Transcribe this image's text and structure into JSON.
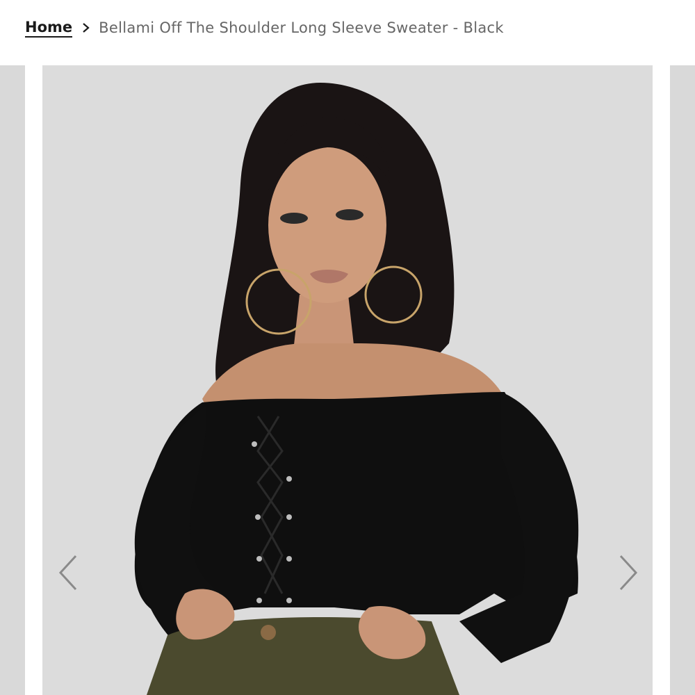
{
  "breadcrumb": {
    "home_label": "Home",
    "current_label": "Bellami Off The Shoulder Long Sleeve Sweater - Black"
  },
  "gallery": {
    "main_image_icon": "product-photo",
    "prev_icon": "chevron-left-icon",
    "next_icon": "chevron-right-icon"
  },
  "colors": {
    "background": "#ffffff",
    "slide_bg": "#dcdcdc",
    "arrow": "#8a8a8a",
    "text": "#666666",
    "link": "#1a1a1a"
  }
}
